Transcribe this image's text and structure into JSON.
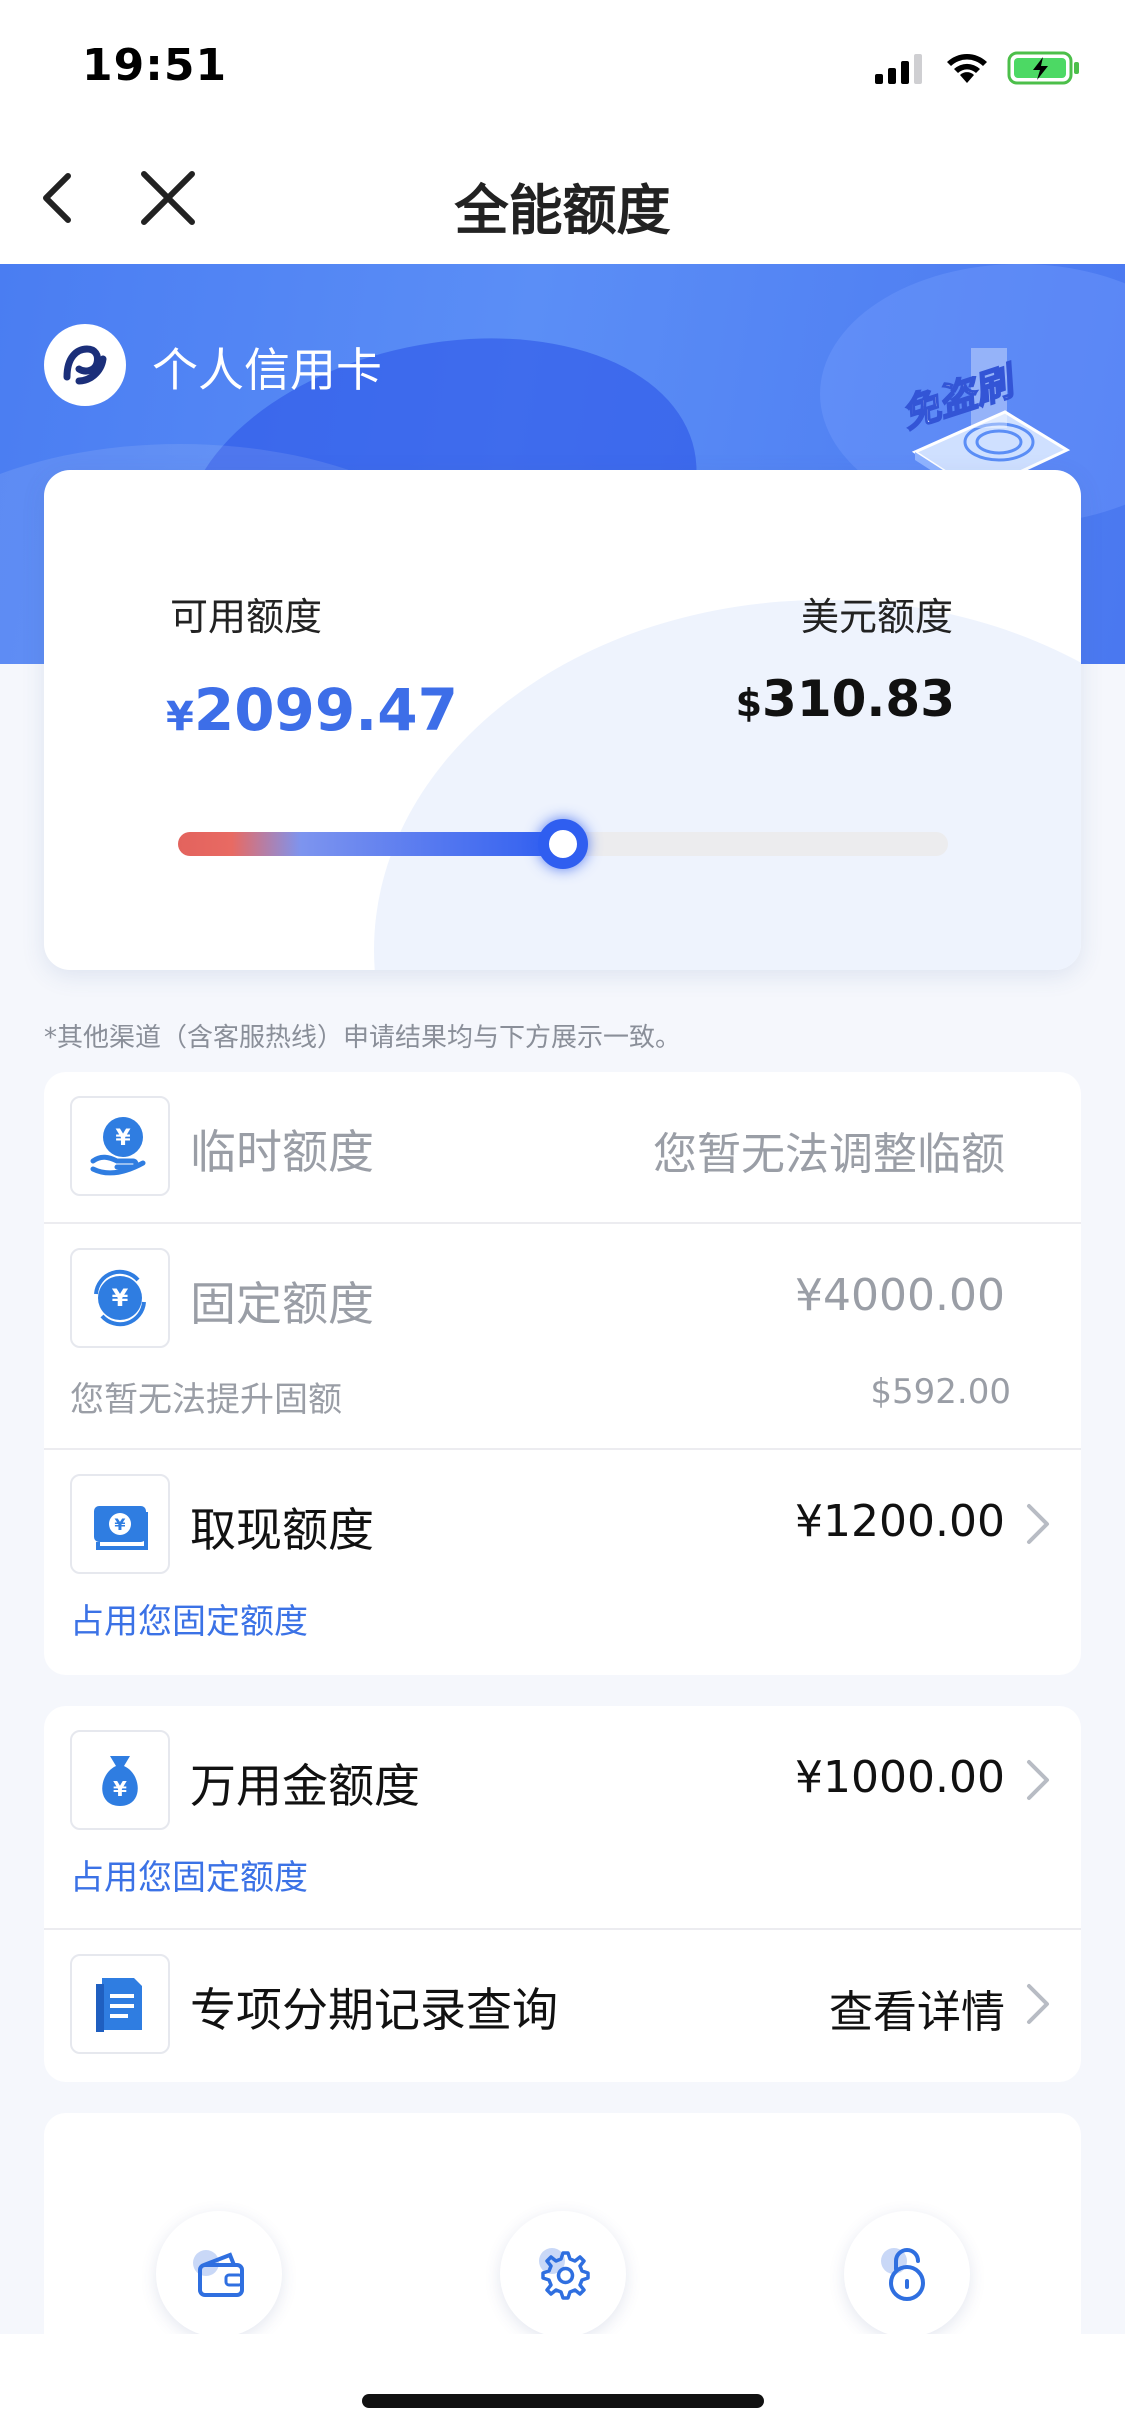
{
  "status_bar": {
    "time": "19:51",
    "icons": [
      "signal-icon",
      "wifi-icon",
      "battery-charging-icon"
    ]
  },
  "nav": {
    "title": "全能额度",
    "back_icon": "chevron-left-icon",
    "close_icon": "close-icon"
  },
  "header": {
    "brand_name": "个人信用卡",
    "badge_text": "免盗刷",
    "colors": {
      "hero_blue": "#4a7df2"
    }
  },
  "card": {
    "available_label": "可用额度",
    "available_currency": "¥",
    "available_amount": "2099.47",
    "usd_label": "美元额度",
    "usd_currency": "$",
    "usd_amount": "310.83",
    "usage_fraction": 0.5
  },
  "notice": "*其他渠道（含客服热线）申请结果均与下方展示一致。",
  "limits": {
    "temporary": {
      "title": "临时额度",
      "value": "您暂无法调整临额"
    },
    "fixed": {
      "title": "固定额度",
      "value": "¥4000.00",
      "sub_label": "您暂无法提升固额",
      "sub_value": "$592.00"
    },
    "cash": {
      "title": "取现额度",
      "value": "¥1200.00",
      "sub_label": "占用您固定额度"
    },
    "wanyongjin": {
      "title": "万用金额度",
      "value": "¥1000.00",
      "sub_label": "占用您固定额度"
    },
    "installment": {
      "title": "专项分期记录查询",
      "value": "查看详情"
    }
  },
  "tools": [
    "wallet-icon",
    "gear-icon",
    "unlock-icon"
  ],
  "colors": {
    "accent": "#3b72e6",
    "grey_text": "#9a9ea6",
    "slider_red": "#e3635d",
    "slider_blue": "#2f5ef0"
  }
}
